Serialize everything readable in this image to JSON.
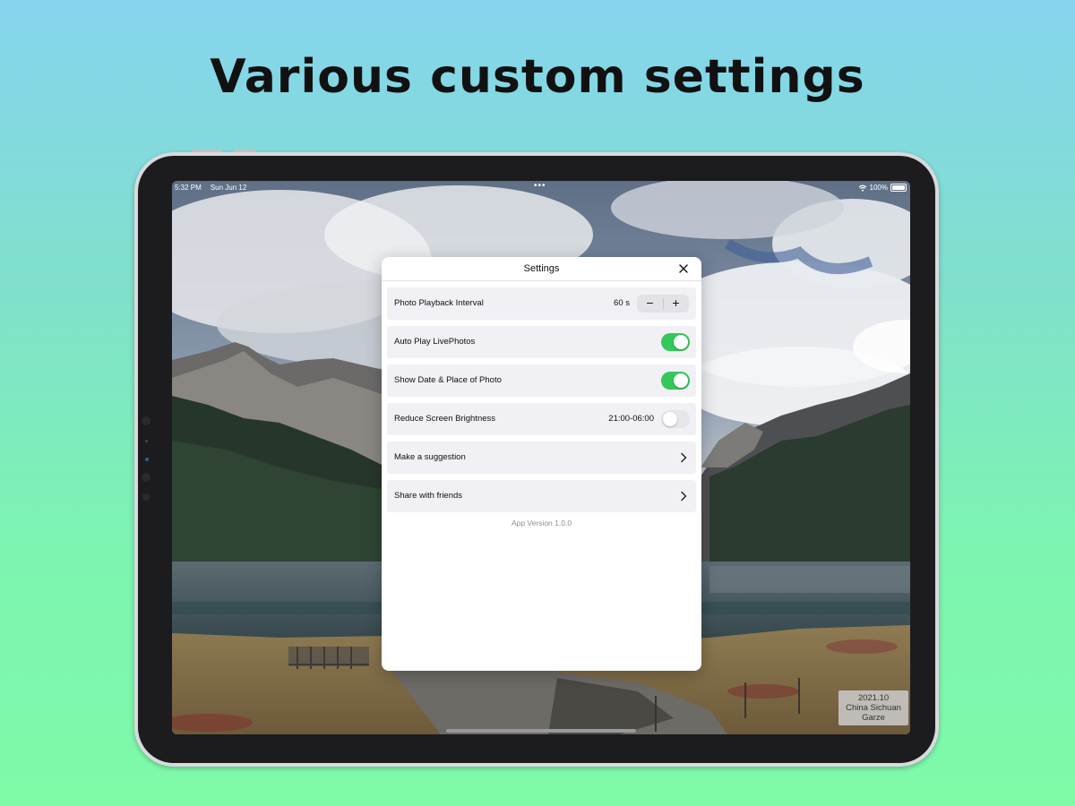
{
  "headline": "Various custom settings",
  "status_bar": {
    "time": "5:32 PM",
    "date": "Sun Jun 12",
    "battery": "100%"
  },
  "photo_caption": {
    "date": "2021.10",
    "place_line1": "China Sichuan",
    "place_line2": "Garze"
  },
  "settings": {
    "title": "Settings",
    "rows": [
      {
        "label": "Photo Playback Interval",
        "value": "60 s",
        "control": "stepper"
      },
      {
        "label": "Auto Play LivePhotos",
        "control": "toggle",
        "on": true
      },
      {
        "label": "Show Date & Place of Photo",
        "control": "toggle",
        "on": true
      },
      {
        "label": "Reduce Screen Brightness",
        "value": "21:00-06:00",
        "control": "toggle",
        "on": false
      },
      {
        "label": "Make a suggestion",
        "control": "chevron"
      },
      {
        "label": "Share with friends",
        "control": "chevron"
      }
    ],
    "stepper": {
      "minus": "−",
      "plus": "+"
    },
    "app_version": "App Version 1.0.0"
  },
  "colors": {
    "toggle_on": "#34c759",
    "toggle_off": "#e5e5ea",
    "row_background": "#f0f0f5"
  },
  "icons": [
    "close-icon",
    "minus-icon",
    "plus-icon",
    "chevron-right-icon",
    "wifi-icon",
    "battery-icon"
  ]
}
